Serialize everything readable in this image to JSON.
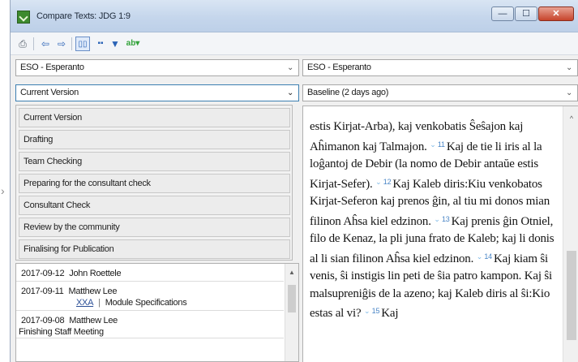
{
  "window": {
    "title": "Compare Texts: JDG 1:9",
    "controls": {
      "minimize": "—",
      "maximize": "☐",
      "close": "✕"
    }
  },
  "toolbar": {
    "icons": [
      "printer-icon",
      "arrow-left-icon",
      "arrow-right-icon",
      "view-single-icon",
      "view-split-icon",
      "filter-icon",
      "color-picker-icon"
    ],
    "glyphs": {
      "print": "⎙",
      "back": "⇦",
      "forward": "⇨",
      "view1": "▯▯",
      "view2": "▪▪",
      "filter": "▼",
      "color": "ab▾"
    }
  },
  "left": {
    "project": "ESO - Esperanto",
    "version_selected": "Current Version",
    "version_options": [
      "Current Version",
      "Drafting",
      "Team Checking",
      "Preparing for the consultant check",
      "Consultant Check",
      "Review by the community",
      "Finalising for Publication"
    ]
  },
  "right": {
    "project": "ESO - Esperanto",
    "version_selected": "Baseline (2 days ago)"
  },
  "history": [
    {
      "date": "2017-09-12",
      "user": "John Roettele"
    },
    {
      "date": "2017-09-11",
      "user": "Matthew Lee",
      "link": "XXA",
      "link2": "Module Specifications"
    },
    {
      "date": "2017-09-08",
      "user": "Matthew Lee",
      "note": "Finishing Staff Meeting"
    }
  ],
  "passage": {
    "intro": "estis Kirjat-Arba), kaj venkobatis Ŝeŝajon kaj Aĥimanon kaj Talmajon.",
    "v11_num": "11",
    "v11_text": "Kaj de tie li iris al la loĝantoj de Debir (la nomo de Debir antaŭe estis Kirjat-Sefer).",
    "v12_num": "12",
    "v12_text": "Kaj Kaleb diris:Kiu venkobatos Kirjat-Seferon kaj prenos ĝin, al tiu mi donos mian filinon Aĥsa kiel edzinon.",
    "v13_num": "13",
    "v13_text": "Kaj prenis ĝin Otniel, filo de Kenaz, la pli juna frato de Kaleb; kaj li donis al li sian filinon Aĥsa kiel edzinon.",
    "v14_num": "14",
    "v14_text": "Kaj kiam ŝi venis, ŝi instigis lin peti de ŝia patro kampon. Kaj ŝi malsupreniĝis de la azeno; kaj Kaleb diris al ŝi:Kio estas al vi?",
    "v15_num": "15",
    "v15_text": "Kaj",
    "verse_marker": "⌄"
  },
  "colors": {
    "accent": "#3c7fb1",
    "verse_number": "#4a86c6",
    "title_bar": "#c5d6ec",
    "close_button": "#c7442b"
  }
}
